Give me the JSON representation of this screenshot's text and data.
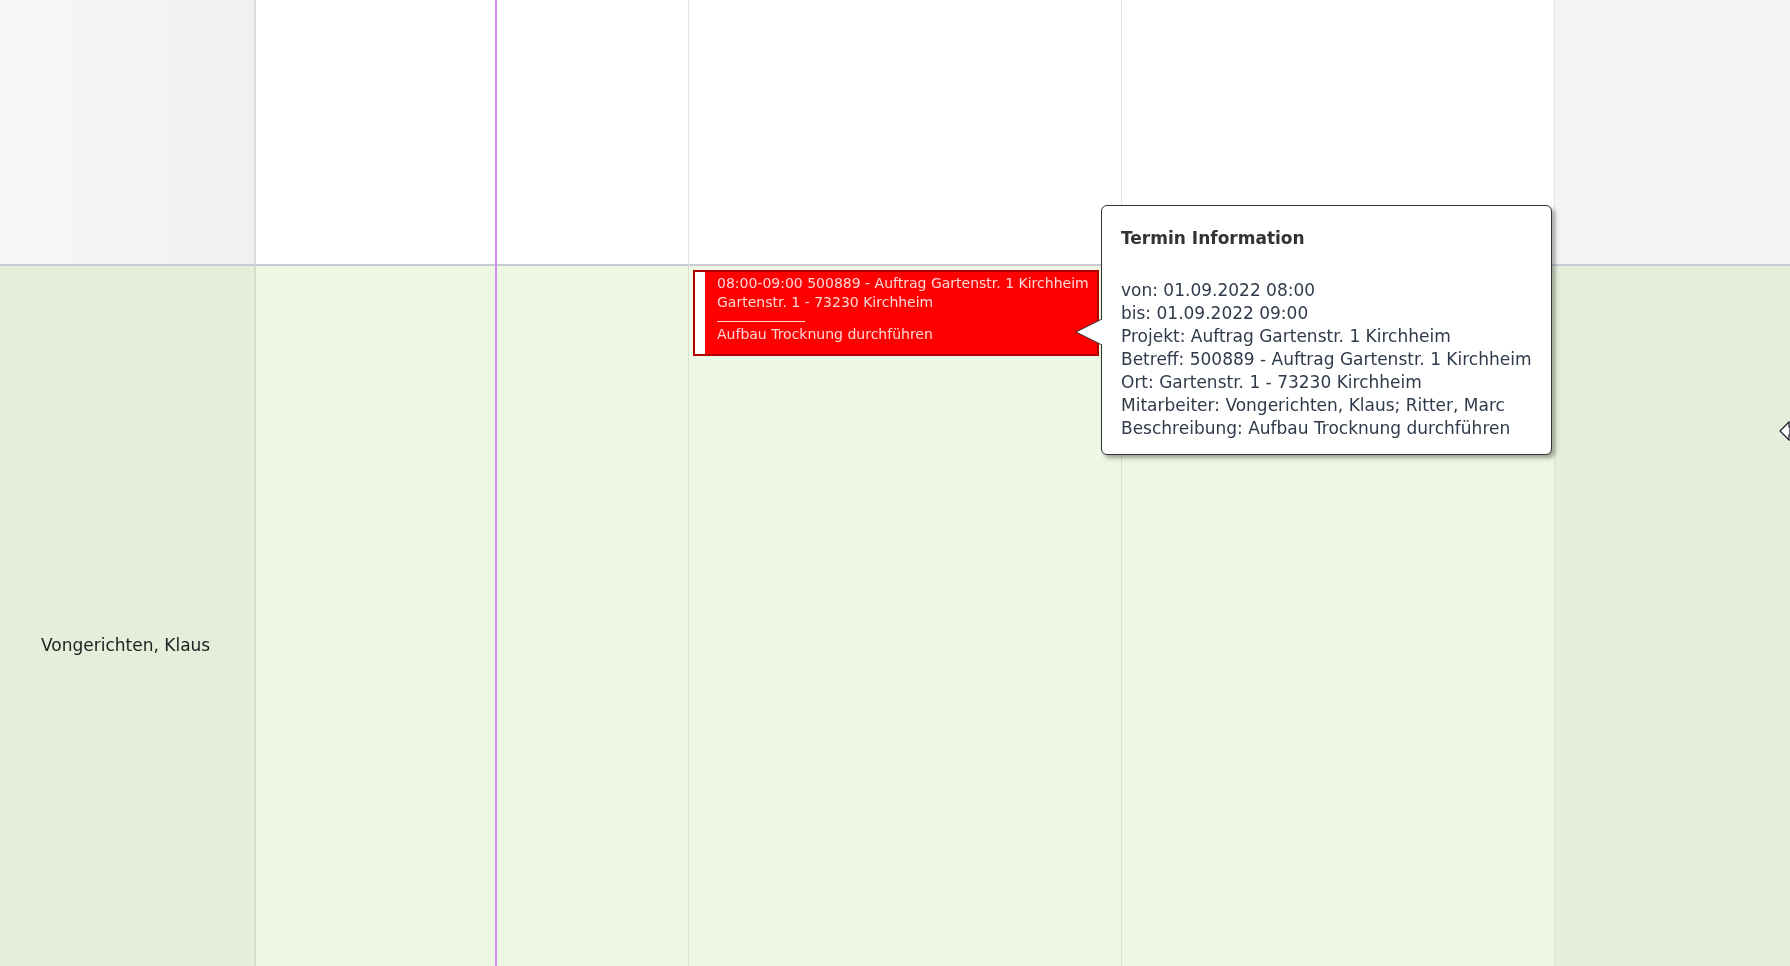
{
  "resource_row": {
    "name": "Vongerichten, Klaus"
  },
  "appointment": {
    "color": "#ff0000",
    "lines": [
      "08:00-09:00 500889 - Auftrag Gartenstr. 1 Kirchheim",
      "Gartenstr. 1 - 73230 Kirchheim"
    ],
    "description": "Aufbau Trocknung durchführen"
  },
  "tooltip": {
    "title": "Termin Information",
    "lines": [
      "von: 01.09.2022 08:00",
      "bis: 01.09.2022 09:00",
      "Projekt: Auftrag Gartenstr. 1 Kirchheim",
      "Betreff: 500889 - Auftrag Gartenstr. 1 Kirchheim",
      "Ort: Gartenstr. 1 - 73230 Kirchheim",
      "Mitarbeiter: Vongerichten, Klaus; Ritter, Marc",
      "Beschreibung: Aufbau Trocknung durchführen"
    ]
  }
}
